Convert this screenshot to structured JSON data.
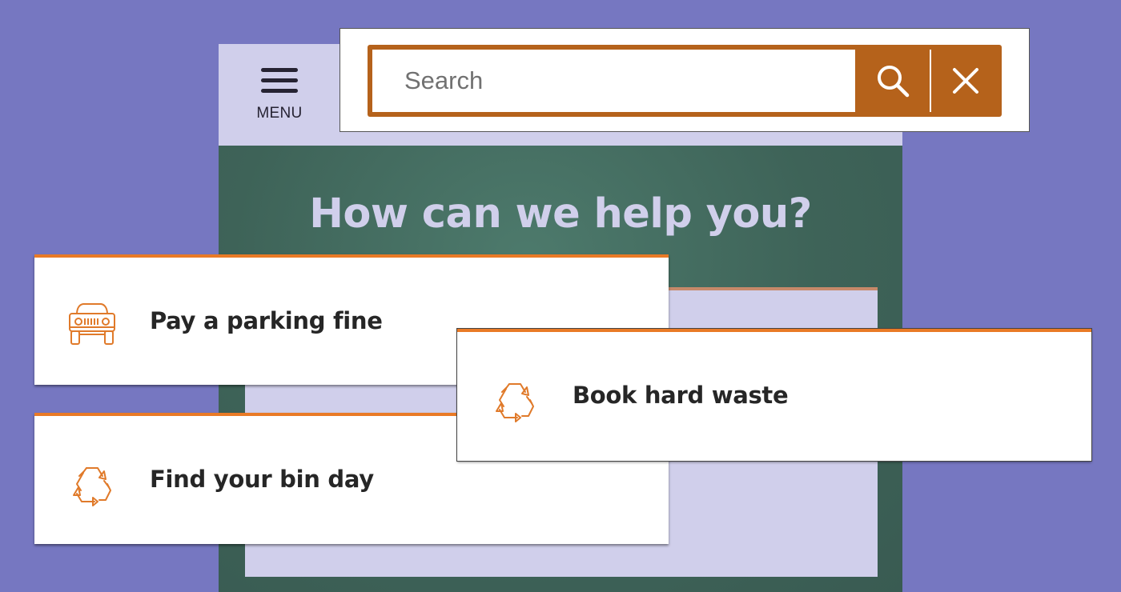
{
  "header": {
    "menu_label": "MENU",
    "menu_icon": "hamburger-icon"
  },
  "search": {
    "placeholder": "Search",
    "value": "",
    "submit_icon": "search-icon",
    "close_icon": "close-icon"
  },
  "hero": {
    "title": "How can we help you?"
  },
  "cards": {
    "parking": {
      "label": "Pay a parking fine",
      "icon": "car-icon"
    },
    "hard_waste": {
      "label": "Book hard waste",
      "icon": "recycle-icon"
    },
    "bin_day": {
      "label": "Find your bin day",
      "icon": "recycle-icon"
    }
  },
  "colors": {
    "page_background": "#7677c1",
    "header_background": "#d0cfeb",
    "hero_background": "#3f6359",
    "accent": "#b5621b",
    "card_accent": "#e97a26",
    "icon": "#e07a2a",
    "text": "#262626"
  }
}
